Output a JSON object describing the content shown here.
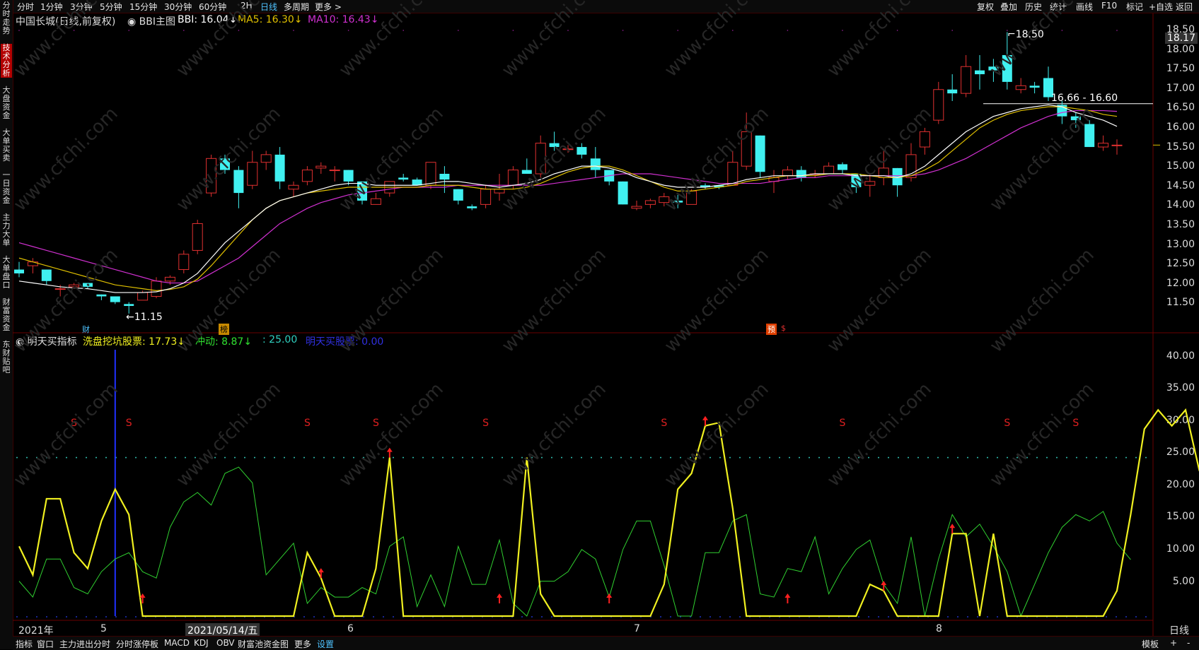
{
  "topbar": {
    "periods": [
      "分时",
      "1分钟",
      "3分钟",
      "5分钟",
      "15分钟",
      "30分钟",
      "60分钟",
      "2H",
      "日线",
      "多周期",
      "更多 >"
    ],
    "active_period": "日线",
    "tools": [
      "复权",
      "叠加",
      "历史",
      "统计",
      "画线",
      "F10",
      "标记",
      "+自选",
      "返回"
    ]
  },
  "leftbar": {
    "tabs": [
      "分时走势",
      "技术分析",
      "大盘资金",
      "大单买卖",
      "一日资金",
      "主力大单",
      "大单盘口",
      "财富资金",
      "东财贴吧"
    ],
    "active_tab": "技术分析"
  },
  "main_chart": {
    "stock": "中国长城(日线,前复权)",
    "indicator": "BBI主图",
    "bbi_label": "BBI: 16.04↓",
    "ma5_label": "MA5: 16.30↓",
    "ma10_label": "MA10: 16.43↓",
    "colors": {
      "bbi": "#ffffff",
      "ma5": "#e0c000",
      "ma10": "#d030d0",
      "up": "#e03030",
      "down": "#40f0f0"
    },
    "y_axis": [
      "18.50",
      "18.00",
      "17.50",
      "17.00",
      "16.50",
      "16.00",
      "15.50",
      "15.00",
      "14.50",
      "14.00",
      "13.50",
      "13.00",
      "12.50",
      "12.00",
      "11.50"
    ],
    "last_price": "18.17",
    "high_marker": "18.50",
    "low_marker": "11.15",
    "range_label": "16.66 - 16.60",
    "badges": {
      "cai": "财",
      "bang": "榜",
      "yu": "预",
      "s": "$"
    }
  },
  "chart_data": {
    "type": "candlestick",
    "ylim": [
      11.0,
      18.6
    ],
    "candles": [
      {
        "o": 12.3,
        "h": 12.5,
        "l": 12.1,
        "c": 12.2
      },
      {
        "o": 12.4,
        "h": 12.6,
        "l": 12.2,
        "c": 12.5
      },
      {
        "o": 12.3,
        "h": 12.3,
        "l": 11.9,
        "c": 12.0
      },
      {
        "o": 11.8,
        "h": 11.9,
        "l": 11.6,
        "c": 11.8
      },
      {
        "o": 11.85,
        "h": 11.95,
        "l": 11.8,
        "c": 11.9
      },
      {
        "o": 11.95,
        "h": 11.95,
        "l": 11.8,
        "c": 11.85
      },
      {
        "o": 11.65,
        "h": 11.65,
        "l": 11.5,
        "c": 11.6
      },
      {
        "o": 11.6,
        "h": 11.6,
        "l": 11.4,
        "c": 11.45
      },
      {
        "o": 11.4,
        "h": 11.45,
        "l": 11.15,
        "c": 11.35
      },
      {
        "o": 11.5,
        "h": 11.75,
        "l": 11.5,
        "c": 11.7
      },
      {
        "o": 11.6,
        "h": 12.1,
        "l": 11.55,
        "c": 12.0
      },
      {
        "o": 12.0,
        "h": 12.15,
        "l": 11.9,
        "c": 12.1
      },
      {
        "o": 12.3,
        "h": 12.8,
        "l": 12.2,
        "c": 12.7
      },
      {
        "o": 12.8,
        "h": 13.6,
        "l": 12.7,
        "c": 13.5
      },
      {
        "o": 14.3,
        "h": 15.3,
        "l": 14.2,
        "c": 15.2
      },
      {
        "o": 15.2,
        "h": 15.3,
        "l": 14.8,
        "c": 14.9
      },
      {
        "o": 14.9,
        "h": 15.0,
        "l": 13.9,
        "c": 14.3
      },
      {
        "o": 14.5,
        "h": 15.4,
        "l": 14.4,
        "c": 15.1
      },
      {
        "o": 15.1,
        "h": 15.4,
        "l": 14.9,
        "c": 15.3
      },
      {
        "o": 15.3,
        "h": 15.5,
        "l": 14.4,
        "c": 14.6
      },
      {
        "o": 14.4,
        "h": 14.6,
        "l": 14.2,
        "c": 14.5
      },
      {
        "o": 14.6,
        "h": 15.0,
        "l": 14.5,
        "c": 14.9
      },
      {
        "o": 14.95,
        "h": 15.1,
        "l": 14.8,
        "c": 15.0
      },
      {
        "o": 14.9,
        "h": 15.0,
        "l": 14.6,
        "c": 14.9
      },
      {
        "o": 14.9,
        "h": 14.9,
        "l": 14.5,
        "c": 14.6
      },
      {
        "o": 14.6,
        "h": 14.6,
        "l": 14.0,
        "c": 14.1
      },
      {
        "o": 14.0,
        "h": 14.3,
        "l": 14.0,
        "c": 14.15
      },
      {
        "o": 14.3,
        "h": 14.6,
        "l": 14.2,
        "c": 14.6
      },
      {
        "o": 14.7,
        "h": 14.8,
        "l": 14.6,
        "c": 14.65
      },
      {
        "o": 14.65,
        "h": 14.7,
        "l": 14.5,
        "c": 14.5
      },
      {
        "o": 14.5,
        "h": 15.1,
        "l": 14.4,
        "c": 15.1
      },
      {
        "o": 14.8,
        "h": 15.0,
        "l": 14.3,
        "c": 14.65
      },
      {
        "o": 14.4,
        "h": 14.4,
        "l": 14.0,
        "c": 14.1
      },
      {
        "o": 13.95,
        "h": 14.0,
        "l": 13.85,
        "c": 13.9
      },
      {
        "o": 14.0,
        "h": 14.5,
        "l": 13.9,
        "c": 14.4
      },
      {
        "o": 14.3,
        "h": 14.8,
        "l": 14.1,
        "c": 14.4
      },
      {
        "o": 14.5,
        "h": 15.0,
        "l": 14.4,
        "c": 14.9
      },
      {
        "o": 14.9,
        "h": 15.2,
        "l": 14.8,
        "c": 14.8
      },
      {
        "o": 14.8,
        "h": 15.8,
        "l": 14.7,
        "c": 15.6
      },
      {
        "o": 15.6,
        "h": 15.9,
        "l": 15.4,
        "c": 15.5
      },
      {
        "o": 15.45,
        "h": 15.55,
        "l": 15.35,
        "c": 15.45
      },
      {
        "o": 15.5,
        "h": 15.6,
        "l": 15.2,
        "c": 15.3
      },
      {
        "o": 15.2,
        "h": 15.5,
        "l": 14.7,
        "c": 14.9
      },
      {
        "o": 14.9,
        "h": 14.9,
        "l": 14.5,
        "c": 14.6
      },
      {
        "o": 14.6,
        "h": 14.6,
        "l": 14.0,
        "c": 14.0
      },
      {
        "o": 13.9,
        "h": 14.1,
        "l": 13.85,
        "c": 13.95
      },
      {
        "o": 14.0,
        "h": 14.15,
        "l": 13.9,
        "c": 14.1
      },
      {
        "o": 14.05,
        "h": 14.3,
        "l": 13.95,
        "c": 14.2
      },
      {
        "o": 14.1,
        "h": 14.25,
        "l": 13.9,
        "c": 14.05
      },
      {
        "o": 14.0,
        "h": 14.4,
        "l": 14.0,
        "c": 14.35
      },
      {
        "o": 14.5,
        "h": 14.55,
        "l": 14.4,
        "c": 14.45
      },
      {
        "o": 14.5,
        "h": 14.5,
        "l": 14.4,
        "c": 14.45
      },
      {
        "o": 14.5,
        "h": 15.4,
        "l": 14.5,
        "c": 15.1
      },
      {
        "o": 15.0,
        "h": 16.4,
        "l": 14.9,
        "c": 15.9
      },
      {
        "o": 15.8,
        "h": 15.8,
        "l": 14.7,
        "c": 14.85
      },
      {
        "o": 14.6,
        "h": 14.9,
        "l": 14.3,
        "c": 14.7
      },
      {
        "o": 14.75,
        "h": 15.0,
        "l": 14.65,
        "c": 14.9
      },
      {
        "o": 14.9,
        "h": 15.0,
        "l": 14.6,
        "c": 14.7
      },
      {
        "o": 14.8,
        "h": 14.9,
        "l": 14.7,
        "c": 14.8
      },
      {
        "o": 14.8,
        "h": 15.1,
        "l": 14.8,
        "c": 15.0
      },
      {
        "o": 15.05,
        "h": 15.1,
        "l": 14.8,
        "c": 14.9
      },
      {
        "o": 14.8,
        "h": 14.8,
        "l": 14.3,
        "c": 14.45
      },
      {
        "o": 14.5,
        "h": 14.8,
        "l": 14.2,
        "c": 14.6
      },
      {
        "o": 14.7,
        "h": 15.4,
        "l": 14.5,
        "c": 14.95
      },
      {
        "o": 14.95,
        "h": 14.95,
        "l": 14.2,
        "c": 14.5
      },
      {
        "o": 14.7,
        "h": 15.6,
        "l": 14.6,
        "c": 15.3
      },
      {
        "o": 15.5,
        "h": 16.0,
        "l": 15.3,
        "c": 15.9
      },
      {
        "o": 16.2,
        "h": 17.2,
        "l": 16.1,
        "c": 17.0
      },
      {
        "o": 17.0,
        "h": 17.4,
        "l": 16.7,
        "c": 16.9
      },
      {
        "o": 16.9,
        "h": 17.9,
        "l": 16.8,
        "c": 17.6
      },
      {
        "o": 17.5,
        "h": 17.9,
        "l": 17.0,
        "c": 17.4
      },
      {
        "o": 17.6,
        "h": 17.8,
        "l": 17.2,
        "c": 17.5
      },
      {
        "o": 17.9,
        "h": 18.5,
        "l": 17.0,
        "c": 17.2
      },
      {
        "o": 17.0,
        "h": 17.3,
        "l": 16.9,
        "c": 17.1
      },
      {
        "o": 17.1,
        "h": 17.2,
        "l": 16.9,
        "c": 17.05
      },
      {
        "o": 17.3,
        "h": 17.6,
        "l": 16.7,
        "c": 16.8
      },
      {
        "o": 16.6,
        "h": 16.7,
        "l": 16.1,
        "c": 16.3
      },
      {
        "o": 16.3,
        "h": 16.4,
        "l": 16.0,
        "c": 16.2
      },
      {
        "o": 16.1,
        "h": 16.2,
        "l": 15.5,
        "c": 15.5
      },
      {
        "o": 15.5,
        "h": 15.8,
        "l": 15.4,
        "c": 15.6
      },
      {
        "o": 15.55,
        "h": 15.7,
        "l": 15.3,
        "c": 15.55
      }
    ],
    "bbi": [
      12.0,
      11.95,
      11.9,
      11.85,
      11.82,
      11.8,
      11.75,
      11.7,
      11.7,
      11.7,
      11.72,
      11.8,
      11.95,
      12.2,
      12.6,
      13.0,
      13.3,
      13.6,
      13.9,
      14.1,
      14.2,
      14.3,
      14.4,
      14.5,
      14.55,
      14.55,
      14.5,
      14.5,
      14.5,
      14.5,
      14.55,
      14.6,
      14.6,
      14.55,
      14.5,
      14.45,
      14.5,
      14.55,
      14.65,
      14.8,
      14.9,
      15.0,
      15.0,
      14.95,
      14.85,
      14.7,
      14.6,
      14.5,
      14.45,
      14.45,
      14.45,
      14.5,
      14.55,
      14.65,
      14.7,
      14.75,
      14.75,
      14.75,
      14.8,
      14.8,
      14.8,
      14.75,
      14.75,
      14.75,
      14.7,
      14.8,
      15.0,
      15.3,
      15.6,
      15.9,
      16.1,
      16.3,
      16.4,
      16.5,
      16.55,
      16.6,
      16.55,
      16.4,
      16.3,
      16.2,
      16.04
    ],
    "ma5": [
      12.6,
      12.5,
      12.4,
      12.3,
      12.2,
      12.1,
      12.0,
      11.9,
      11.85,
      11.8,
      11.75,
      11.78,
      11.85,
      12.05,
      12.4,
      12.8,
      13.2,
      13.6,
      13.9,
      14.1,
      14.2,
      14.3,
      14.35,
      14.4,
      14.45,
      14.45,
      14.45,
      14.45,
      14.45,
      14.45,
      14.5,
      14.5,
      14.5,
      14.45,
      14.4,
      14.4,
      14.4,
      14.45,
      14.55,
      14.7,
      14.85,
      14.95,
      15.0,
      15.0,
      14.9,
      14.75,
      14.6,
      14.45,
      14.35,
      14.35,
      14.4,
      14.45,
      14.5,
      14.6,
      14.65,
      14.7,
      14.75,
      14.75,
      14.75,
      14.8,
      14.8,
      14.8,
      14.75,
      14.7,
      14.7,
      14.75,
      14.9,
      15.1,
      15.4,
      15.7,
      16.0,
      16.2,
      16.35,
      16.45,
      16.5,
      16.55,
      16.55,
      16.5,
      16.45,
      16.35,
      16.3
    ],
    "ma10": [
      13.0,
      12.9,
      12.8,
      12.7,
      12.6,
      12.5,
      12.4,
      12.3,
      12.2,
      12.1,
      12.0,
      11.95,
      11.95,
      12.0,
      12.2,
      12.4,
      12.6,
      12.9,
      13.2,
      13.5,
      13.7,
      13.9,
      14.05,
      14.15,
      14.25,
      14.3,
      14.35,
      14.4,
      14.45,
      14.45,
      14.45,
      14.45,
      14.5,
      14.5,
      14.5,
      14.5,
      14.5,
      14.5,
      14.5,
      14.55,
      14.6,
      14.65,
      14.7,
      14.75,
      14.8,
      14.8,
      14.8,
      14.75,
      14.7,
      14.65,
      14.6,
      14.55,
      14.55,
      14.55,
      14.55,
      14.6,
      14.65,
      14.7,
      14.7,
      14.75,
      14.75,
      14.75,
      14.75,
      14.75,
      14.75,
      14.75,
      14.8,
      14.9,
      15.05,
      15.2,
      15.4,
      15.6,
      15.8,
      16.0,
      16.15,
      16.3,
      16.4,
      16.45,
      16.45,
      16.45,
      16.43
    ]
  },
  "sub_chart": {
    "name": "明天买指标",
    "line1_label": "洗盘挖坑股票: 17.73↓",
    "line2_label": "冲动: 8.87↓",
    "line3_label": ": 25.00",
    "line4_label": "明天买股票: 0.00",
    "y_axis": [
      "40.00",
      "35.00",
      "30.00",
      "25.00",
      "20.00",
      "15.00",
      "10.00",
      "5.00"
    ],
    "ylim": [
      0,
      42
    ],
    "threshold": 25,
    "yellow": [
      11,
      6.5,
      18.5,
      18.5,
      10,
      7.5,
      15,
      20,
      16,
      0,
      0,
      0,
      0,
      0,
      0,
      0,
      0,
      0,
      0,
      0,
      0,
      10,
      6,
      0,
      0,
      0,
      7.5,
      25,
      0,
      0,
      0,
      0,
      0,
      0,
      0,
      0,
      0,
      25,
      3.5,
      0,
      0,
      0,
      0,
      0,
      0,
      0,
      0,
      5,
      20,
      22.5,
      30,
      30.5,
      17,
      0,
      0,
      0,
      0,
      0,
      0,
      0,
      0,
      0,
      5,
      4,
      0,
      0,
      0,
      0,
      13,
      13,
      0,
      13,
      0,
      0,
      0,
      0,
      0,
      0,
      0,
      0,
      4,
      16,
      29.5,
      32.5,
      30,
      32.5,
      23,
      17.5
    ],
    "green": [
      5.5,
      3,
      9,
      9,
      4.5,
      3.5,
      7,
      9,
      10,
      7,
      6,
      14,
      18,
      19.5,
      17.5,
      22.5,
      23.5,
      21,
      6.5,
      9,
      11.5,
      2,
      4.5,
      3,
      3,
      4.5,
      3.5,
      11,
      12.5,
      1.5,
      6.5,
      1.5,
      11,
      5,
      5,
      12,
      2,
      0,
      5.5,
      5.5,
      7,
      10.5,
      9,
      3,
      10.5,
      15,
      15,
      8,
      0,
      0,
      10,
      10,
      15,
      16,
      3.5,
      3,
      7.5,
      7,
      12.5,
      3.5,
      7.5,
      10.5,
      12,
      5,
      2,
      12.5,
      0,
      9,
      16,
      12.5,
      14.5,
      11,
      7,
      0,
      5,
      10,
      14,
      16,
      15,
      16.5,
      11.5,
      8.9
    ],
    "sell_signals": [
      4,
      8,
      21,
      26,
      34,
      47,
      60,
      72,
      77
    ],
    "buy_arrows": [
      9,
      22,
      27,
      35,
      43,
      50,
      56,
      63,
      68
    ],
    "blue_line_index": 7
  },
  "x_axis": {
    "dates": [
      "2021年",
      "5",
      "2021/05/14/五",
      "6",
      "7",
      "8"
    ],
    "right_label": "日线"
  },
  "bottombar": {
    "tabs": [
      "指标",
      "窗口",
      "主力进出分时",
      "分时涨停板",
      "MACD",
      "KDJ",
      "OBV",
      "财富池资金图",
      "更多",
      "设置"
    ],
    "active": "设置",
    "right": [
      "模板",
      "+",
      "-"
    ]
  }
}
